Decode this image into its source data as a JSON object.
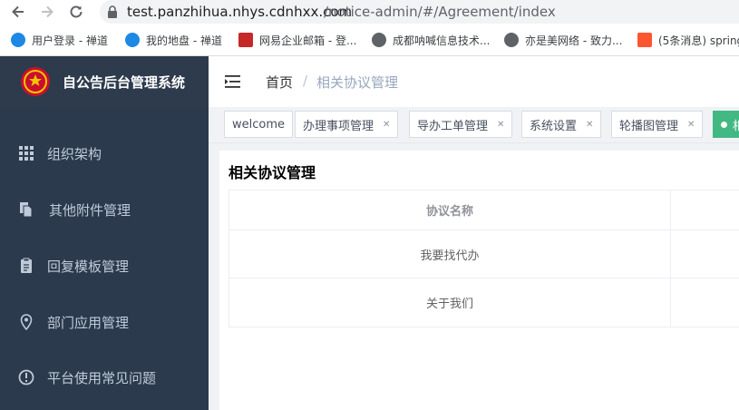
{
  "browser": {
    "url_host": "test.panzhihua.nhys.cdnhxx.com",
    "url_path": "/notice-admin/#/Agreement/index",
    "bookmarks": [
      {
        "label": "用户登录 - 禅道",
        "icon": "chandao-icon",
        "color": "#1e88e5"
      },
      {
        "label": "我的地盘 - 禅道",
        "icon": "chandao-icon",
        "color": "#1e88e5"
      },
      {
        "label": "网易企业邮箱 - 登...",
        "icon": "netease-mail-icon",
        "color": "#c62828"
      },
      {
        "label": "成都呐喊信息技术...",
        "icon": "globe-icon",
        "color": "#5f6368"
      },
      {
        "label": "亦是美网络 - 致力...",
        "icon": "globe-icon",
        "color": "#5f6368"
      },
      {
        "label": "(5条消息) spring",
        "icon": "csdn-icon",
        "color": "#fc5531"
      }
    ]
  },
  "sidebar": {
    "brand_title": "自公告后台管理系统",
    "items": [
      {
        "label": "组织架构",
        "icon": "grid-icon"
      },
      {
        "label": "其他附件管理",
        "icon": "documents-icon"
      },
      {
        "label": "回复模板管理",
        "icon": "clipboard-icon"
      },
      {
        "label": "部门应用管理",
        "icon": "location-pin-icon"
      },
      {
        "label": "平台使用常见问题",
        "icon": "info-circle-icon"
      }
    ]
  },
  "header": {
    "breadcrumb_home": "首页",
    "breadcrumb_sep": "/",
    "breadcrumb_current": "相关协议管理"
  },
  "tags": [
    {
      "label": "welcome",
      "closable": false
    },
    {
      "label": "办理事项管理",
      "closable": true
    },
    {
      "label": "导办工单管理",
      "closable": true
    },
    {
      "label": "系统设置",
      "closable": true
    },
    {
      "label": "轮播图管理",
      "closable": true
    },
    {
      "label": "相",
      "closable": false,
      "active": true
    }
  ],
  "main": {
    "title": "相关协议管理",
    "table": {
      "header": "协议名称",
      "rows": [
        "我要找代办",
        "关于我们"
      ]
    }
  },
  "colors": {
    "sidebar_bg": "#2b3a4d",
    "active_tag": "#42b983"
  }
}
